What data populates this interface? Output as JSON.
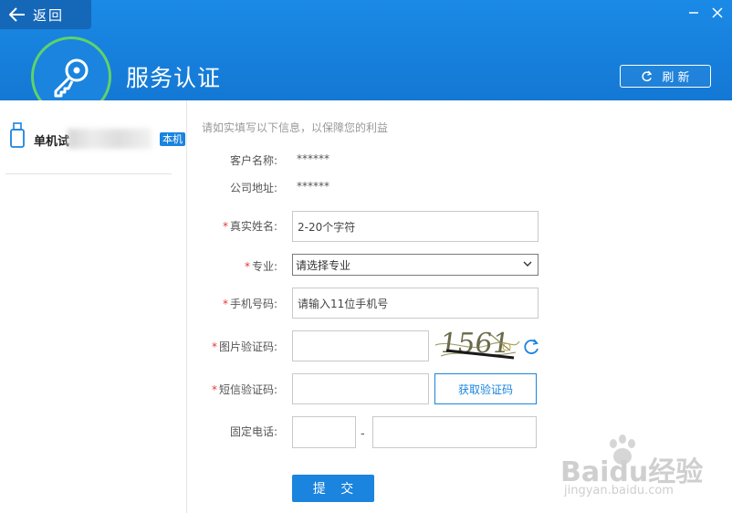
{
  "header": {
    "back_label": "返回",
    "title": "服务认证",
    "refresh_label": "刷 新",
    "accent_color": "#1a84de"
  },
  "sidebar": {
    "device_name": "单机试",
    "device_badge": "本机",
    "device_icon": "usb-drive-icon"
  },
  "form": {
    "hint": "请如实填写以下信息，以保障您的利益",
    "customer_name_label": "客户名称:",
    "customer_name_value": "******",
    "company_address_label": "公司地址:",
    "company_address_value": "******",
    "real_name_label": "真实姓名:",
    "real_name_placeholder": "2-20个字符",
    "major_label": "专业:",
    "major_selected": "请选择专业",
    "phone_label": "手机号码:",
    "phone_placeholder": "请输入11位手机号",
    "captcha_label": "图片验证码:",
    "captcha_text": "1561",
    "sms_label": "短信验证码:",
    "sms_button": "获取验证码",
    "landline_label": "固定电话:",
    "landline_separator": "-",
    "required_mark": "*",
    "submit_label": "提 交"
  },
  "watermark": {
    "brand": "Baidu经验",
    "url": "jingyan.baidu.com"
  }
}
